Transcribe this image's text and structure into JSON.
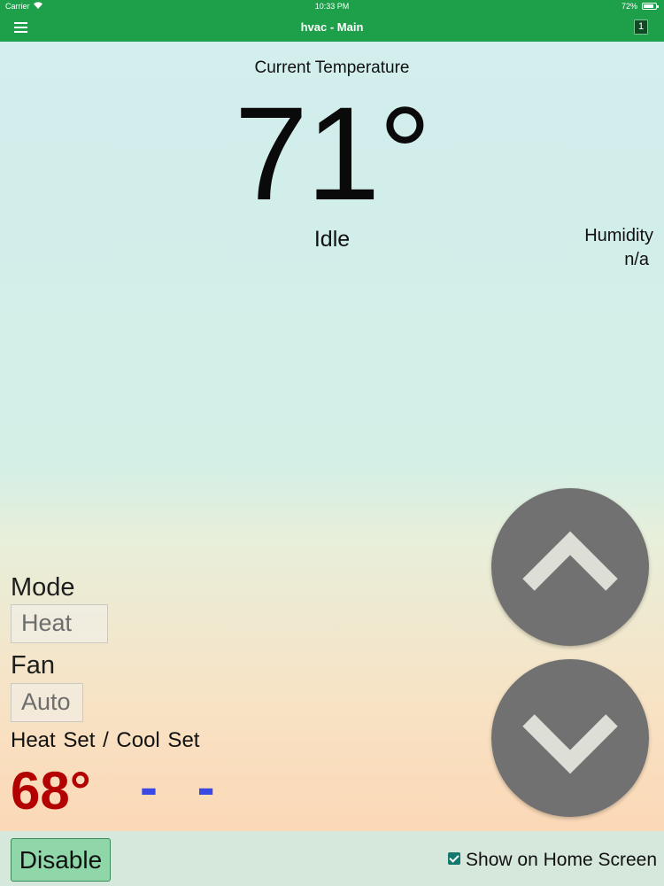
{
  "status_bar": {
    "carrier": "Carrier",
    "time": "10:33 PM",
    "battery": "72%",
    "battery_level": 0.72,
    "icons": [
      "wifi-icon",
      "battery-icon"
    ]
  },
  "nav": {
    "title": "hvac - Main",
    "badge": "1",
    "color": "#1ea04a",
    "icons": [
      "menu-icon"
    ]
  },
  "current": {
    "label": "Current Temperature",
    "temperature": "71°",
    "state": "Idle"
  },
  "humidity": {
    "label": "Humidity",
    "value": "n/a"
  },
  "mode": {
    "label": "Mode",
    "value": "Heat"
  },
  "fan": {
    "label": "Fan",
    "value": "Auto"
  },
  "setpoints": {
    "heat_label": "Heat Set",
    "separator": "/",
    "cool_label": "Cool Set",
    "heat_value": "68°",
    "cool_value": "- -",
    "heat_color": "#b30000",
    "cool_color": "#3a48e4"
  },
  "controls": {
    "up_icon": "chevron-up-icon",
    "down_icon": "chevron-down-icon"
  },
  "footer": {
    "disable_label": "Disable",
    "show_home_label": "Show on Home Screen",
    "show_home_checked": true
  }
}
